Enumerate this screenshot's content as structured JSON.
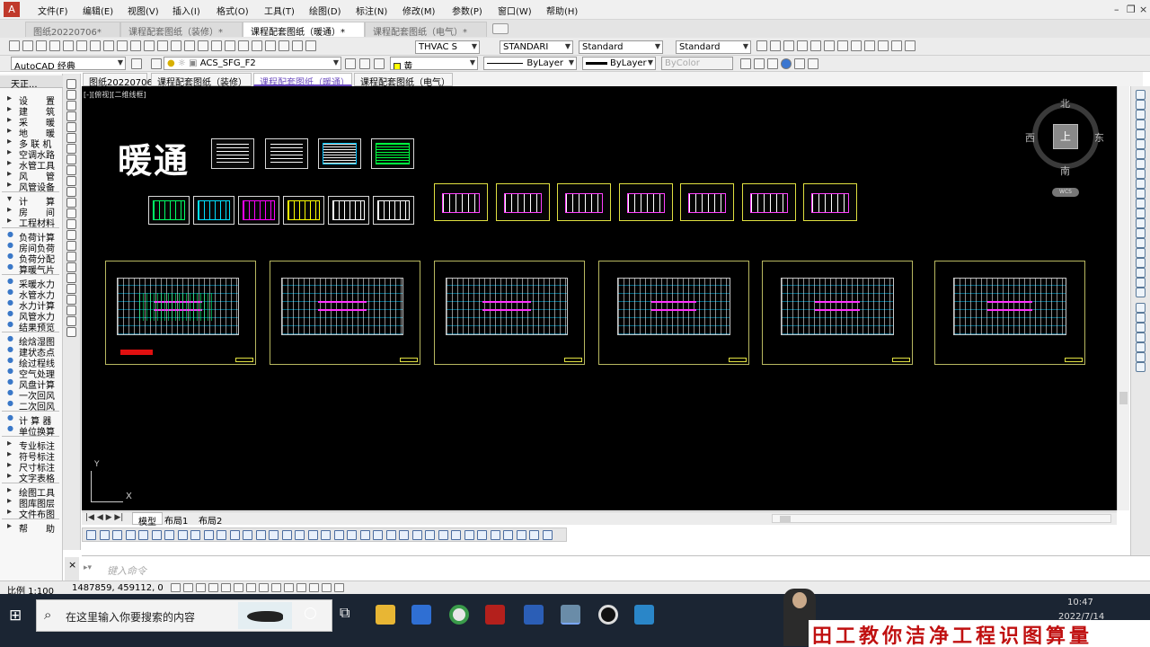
{
  "menubar": {
    "items": [
      "文件(F)",
      "编辑(E)",
      "视图(V)",
      "插入(I)",
      "格式(O)",
      "工具(T)",
      "绘图(D)",
      "标注(N)",
      "修改(M)",
      "参数(P)",
      "窗口(W)",
      "帮助(H)"
    ]
  },
  "doc_tabs": [
    {
      "label": "图纸20220706*",
      "active": false
    },
    {
      "label": "课程配套图纸（装修）*",
      "active": false
    },
    {
      "label": "课程配套图纸（暖通）*",
      "active": true
    },
    {
      "label": "课程配套图纸（电气）*",
      "active": false
    }
  ],
  "toolbar": {
    "text_style": "THVAC S",
    "dim_style": "STANDARI",
    "table_style": "Standard",
    "multileader_style": "Standard",
    "workspace": "AutoCAD 经典",
    "layer": "ACS_SFG_F2",
    "color": "黄",
    "linetype": "ByLayer",
    "lineweight": "ByLayer",
    "plotstyle": "ByColor"
  },
  "file_tabs": [
    {
      "label": "图纸20220706",
      "active": false
    },
    {
      "label": "课程配套图纸（装修）",
      "active": false
    },
    {
      "label": "课程配套图纸（暖通）",
      "active": true
    },
    {
      "label": "课程配套图纸（电气）",
      "active": false
    }
  ],
  "left_panel": {
    "header": "天正...",
    "items": [
      {
        "label": "设　　置",
        "bullet": "▸"
      },
      {
        "label": "建　　筑",
        "bullet": "▸"
      },
      {
        "label": "采　　暖",
        "bullet": "▸"
      },
      {
        "label": "地　　暖",
        "bullet": "▸"
      },
      {
        "label": "多 联 机",
        "bullet": "▸"
      },
      {
        "label": "空调水路",
        "bullet": "▸"
      },
      {
        "label": "水管工具",
        "bullet": "▸"
      },
      {
        "label": "风　　管",
        "bullet": "▸"
      },
      {
        "label": "风管设备",
        "bullet": "▸"
      },
      {
        "label": "计　　算",
        "bullet": "▾"
      },
      {
        "label": "房　　间",
        "bullet": "▸"
      },
      {
        "label": "工程材料",
        "bullet": "▸"
      },
      {
        "label": "负荷计算",
        "bullet": "●"
      },
      {
        "label": "房间负荷",
        "bullet": "●"
      },
      {
        "label": "负荷分配",
        "bullet": "●"
      },
      {
        "label": "算暖气片",
        "bullet": "●"
      },
      {
        "label": "采暖水力",
        "bullet": "●"
      },
      {
        "label": "水管水力",
        "bullet": "●"
      },
      {
        "label": "水力计算",
        "bullet": "●"
      },
      {
        "label": "风管水力",
        "bullet": "●"
      },
      {
        "label": "结果预览",
        "bullet": "●"
      },
      {
        "label": "绘焓湿图",
        "bullet": "●"
      },
      {
        "label": "建状态点",
        "bullet": "●"
      },
      {
        "label": "绘过程线",
        "bullet": "●"
      },
      {
        "label": "空气处理",
        "bullet": "●"
      },
      {
        "label": "风盘计算",
        "bullet": "●"
      },
      {
        "label": "一次回风",
        "bullet": "●"
      },
      {
        "label": "二次回风",
        "bullet": "●"
      },
      {
        "label": "计 算 器",
        "bullet": "●"
      },
      {
        "label": "单位换算",
        "bullet": "●"
      },
      {
        "label": "专业标注",
        "bullet": "▸"
      },
      {
        "label": "符号标注",
        "bullet": "▸"
      },
      {
        "label": "尺寸标注",
        "bullet": "▸"
      },
      {
        "label": "文字表格",
        "bullet": "▸"
      },
      {
        "label": "绘图工具",
        "bullet": "▸"
      },
      {
        "label": "图库图层",
        "bullet": "▸"
      },
      {
        "label": "文件布图",
        "bullet": "▸"
      },
      {
        "label": "帮　　助",
        "bullet": "▸"
      }
    ]
  },
  "canvas": {
    "viewport_label": "[-][俯视][二维线框]",
    "heading": "暖通",
    "viewcube": {
      "north": "北",
      "south": "南",
      "east": "东",
      "west": "西",
      "top": "上",
      "wcs": "WCS"
    },
    "ucs_y": "Y",
    "ucs_x": "X"
  },
  "layout_tabs": [
    "模型",
    "布局1",
    "布局2"
  ],
  "command": {
    "placeholder": "键入命令"
  },
  "status": {
    "scale": "比例 1:100",
    "coords": "1487859, 459112, 0"
  },
  "taskbar": {
    "search_placeholder": "在这里输入你要搜索的内容",
    "time": "10:47",
    "date": "2022/7/14"
  },
  "banner": {
    "text": "田工教你洁净工程识图算量"
  },
  "colors": {
    "canvas_bg": "#000000",
    "accent_tab": "#6b4bbf",
    "banner_text": "#c01010"
  }
}
